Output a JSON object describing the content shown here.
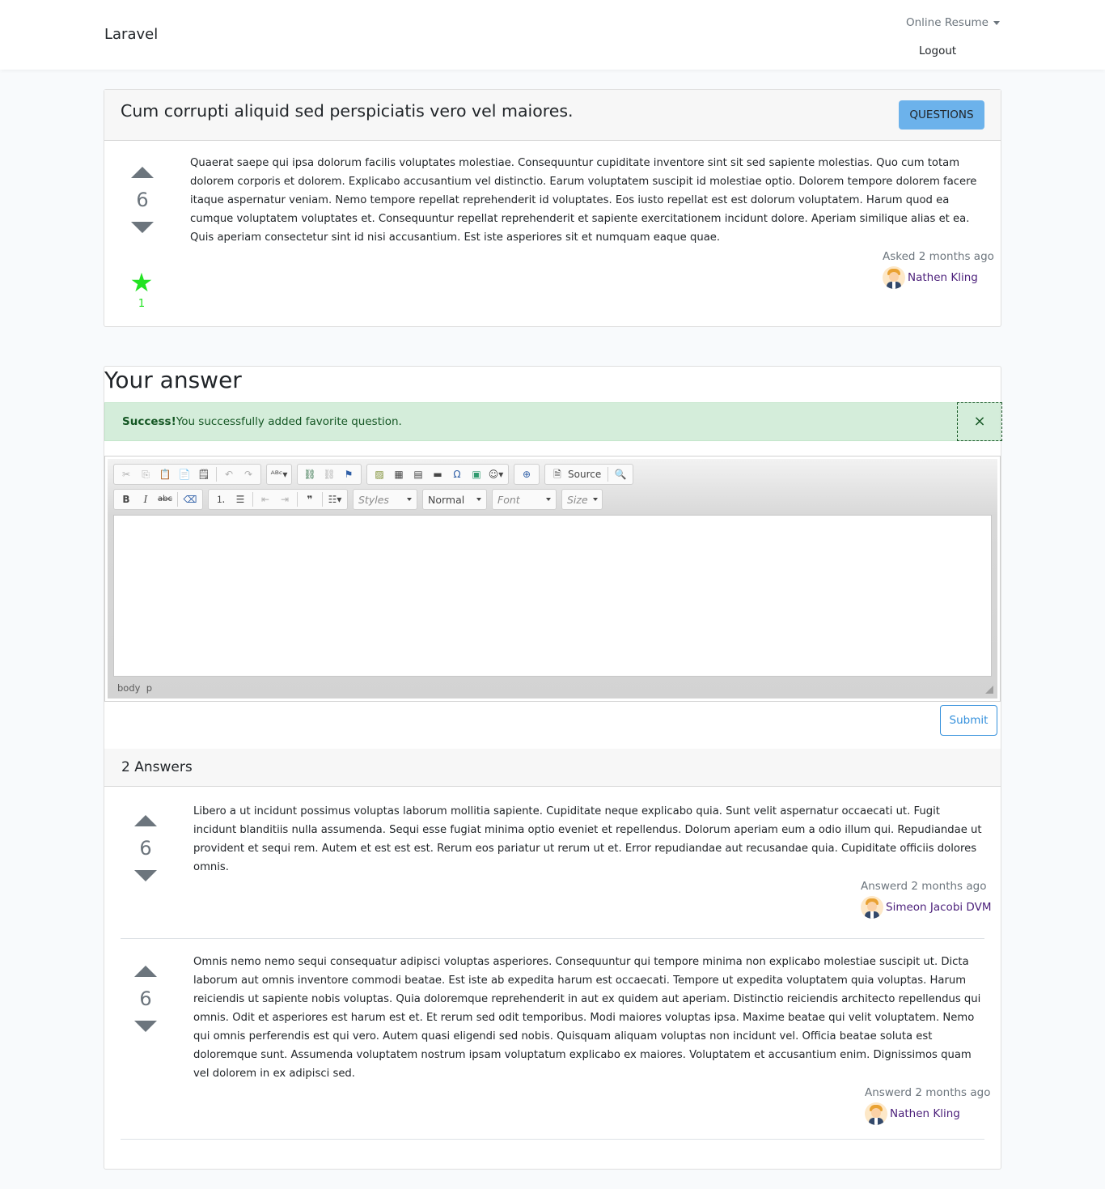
{
  "navbar": {
    "brand": "Laravel",
    "dropdown_label": "Online Resume",
    "logout_label": "Logout"
  },
  "question": {
    "title": "Cum corrupti aliquid sed perspiciatis vero vel maiores.",
    "questions_button": "QUESTIONS",
    "votes": "6",
    "favorites_count": "1",
    "body": "Quaerat saepe qui ipsa dolorum facilis voluptates molestiae. Consequuntur cupiditate inventore sint sit sed sapiente molestias. Quo cum totam dolorem corporis et dolorem. Explicabo accusantium vel distinctio. Earum voluptatem suscipit id molestiae optio. Dolorem tempore dolorem facere itaque aspernatur veniam. Nemo tempore repellat reprehenderit id voluptates. Eos iusto repellat est est dolorum voluptatem. Harum quod ea cumque voluptatem voluptates et. Consequuntur repellat reprehenderit et sapiente exercitationem incidunt dolore. Aperiam similique alias et ea. Quis aperiam consectetur sint id nisi accusantium. Est iste asperiores sit et numquam eaque quae.",
    "asked_label": "Asked 2 months ago",
    "author": "Nathen Kling"
  },
  "answer_form": {
    "heading": "Your answer",
    "alert_strong": "Success!",
    "alert_message": "You successfully added favorite question.",
    "alert_close": "×",
    "toolbar": {
      "source_label": "Source",
      "styles_label": "Styles",
      "format_label": "Normal",
      "font_label": "Font",
      "size_label": "Size"
    },
    "elements_path": "body  p",
    "submit_label": "Submit"
  },
  "answers": {
    "count_label": "2 Answers",
    "items": [
      {
        "votes": "6",
        "body": "Libero a ut incidunt possimus voluptas laborum mollitia sapiente. Cupiditate neque explicabo quia. Sunt velit aspernatur occaecati ut. Fugit incidunt blanditiis nulla assumenda. Sequi esse fugiat minima optio eveniet et repellendus. Dolorum aperiam eum a odio illum qui. Repudiandae ut provident et sequi rem. Autem et est est est. Rerum eos pariatur ut rerum ut et. Error repudiandae aut recusandae quia. Cupiditate officiis dolores omnis.",
        "answered_label": "Answerd 2 months ago",
        "author": "Simeon Jacobi DVM"
      },
      {
        "votes": "6",
        "body": "Omnis nemo nemo sequi consequatur adipisci voluptas asperiores. Consequuntur qui tempore minima non explicabo molestiae suscipit ut. Dicta laborum aut omnis inventore commodi beatae. Est iste ab expedita harum est occaecati. Tempore ut expedita voluptatem quia voluptas. Harum reiciendis ut sapiente nobis voluptas. Quia doloremque reprehenderit in aut ex quidem aut aperiam. Distinctio reiciendis architecto repellendus qui omnis. Odit et asperiores est harum est et. Et rerum sed odit temporibus. Modi maiores voluptas ipsa. Maxime beatae qui velit voluptatem. Nemo qui omnis perferendis est qui vero. Autem quasi eligendi sed nobis. Quisquam aliquam voluptas non incidunt vel. Officia beatae soluta est doloremque sunt. Assumenda voluptatem nostrum ipsam voluptatum explicabo ex maiores. Voluptatem et accusantium enim. Dignissimos quam vel dolorem in ex adipisci sed.",
        "answered_label": "Answerd 2 months ago",
        "author": "Nathen Kling"
      }
    ]
  },
  "colors": {
    "favorite_green": "#22e322",
    "button_blue": "#6cb2eb",
    "link_purple": "#4b1f7a",
    "success_bg": "#d4edda"
  }
}
